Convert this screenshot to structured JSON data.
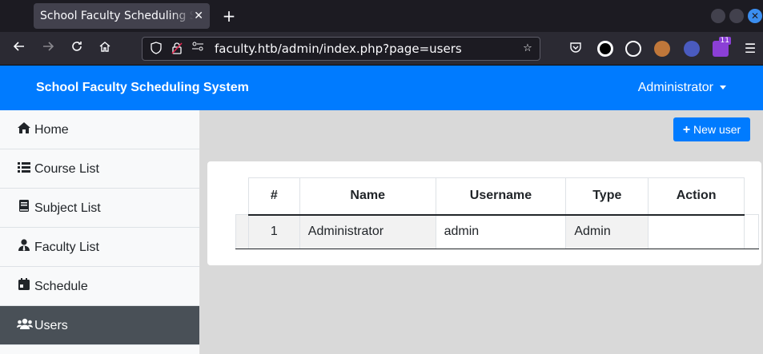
{
  "browser": {
    "tab_title": "School Faculty Scheduling System",
    "url": "faculty.htb/admin/index.php?page=users",
    "extension_badge": "11"
  },
  "app": {
    "brand": "School Faculty Scheduling System",
    "user_menu_label": "Administrator",
    "accent_color": "#007bff"
  },
  "sidebar": {
    "items": [
      {
        "label": "Home",
        "icon": "home-icon"
      },
      {
        "label": "Course List",
        "icon": "list-icon"
      },
      {
        "label": "Subject List",
        "icon": "book-icon"
      },
      {
        "label": "Faculty List",
        "icon": "user-tie-icon"
      },
      {
        "label": "Schedule",
        "icon": "calendar-icon"
      },
      {
        "label": "Users",
        "icon": "users-icon",
        "active": true
      }
    ]
  },
  "main": {
    "new_user_label": "New user",
    "table": {
      "headers": [
        "#",
        "Name",
        "Username",
        "Type",
        "Action"
      ],
      "rows": [
        {
          "num": "1",
          "name": "Administrator",
          "username": "admin",
          "type": "Admin",
          "action": ""
        }
      ]
    }
  }
}
